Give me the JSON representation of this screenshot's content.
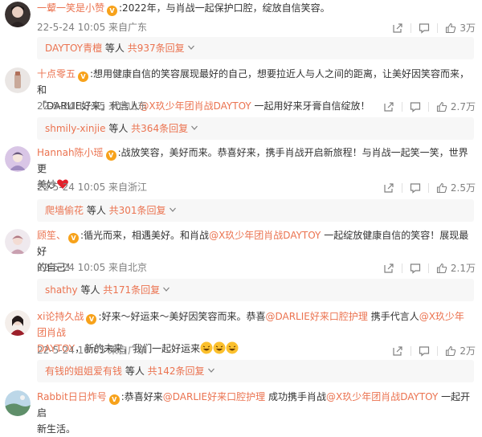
{
  "comments": [
    {
      "username": "一颦一笑是小赞",
      "text_parts": [
        ":2022年，与肖战一起保护口腔，绽放自信笑容。"
      ],
      "meta": "22-5-24 10:05 来自广东",
      "likes": "3万",
      "reply": {
        "user": "DAYTOY青檀",
        "mid": " 等人 ",
        "more": "共937条回复"
      }
    },
    {
      "username": "十点零五",
      "text_parts": [
        ":想用健康自信的笑容展现最好的自己，想要拉近人与人之间的距离，让美好因笑容而来，和",
        "「DARLIE好来」代言人",
        "@X玖少年团肖战DAYTOY",
        " 一起用好来牙膏自信绽放！"
      ],
      "meta": "22-5-24 10:05 来自山东",
      "likes": "2.7万",
      "reply": {
        "user": "shmily-xinjie",
        "mid": " 等人 ",
        "more": "共364条回复"
      }
    },
    {
      "username": "Hannah陈小瑶",
      "text_parts": [
        ":战放笑容，美好而来。恭喜好来，携手肖战开启新旅程！与肖战一起笑一笑，世界更",
        "美妙"
      ],
      "meta": "22-5-24 10:05 来自浙江",
      "likes": "2.5万",
      "reply": {
        "user": "爬墙偷花",
        "mid": " 等人 ",
        "more": "共301条回复"
      }
    },
    {
      "username": "顾笙、",
      "text_parts": [
        ":循光而来，相遇美好。和肖战",
        "@X玖少年团肖战DAYTOY",
        " 一起绽放健康自信的笑容！展现最好",
        "的自己！"
      ],
      "meta": "22-5-24 10:05 来自北京",
      "likes": "2.1万",
      "reply": {
        "user": "shathy",
        "mid": " 等人 ",
        "more": "共171条回复"
      }
    },
    {
      "username": "xi论持久战",
      "text_parts": [
        ":好来～好运来～美好因笑容而来。恭喜",
        "@DARLIE好来口腔护理",
        " 携手代言人",
        "@X玖少年团肖战",
        "DAYTOY",
        "，新的未来，我们一起好运来"
      ],
      "meta": "22-5-24 10:05 来自广东",
      "likes": "2万",
      "reply": {
        "user": "有钱的姐姐爱有钱",
        "mid": " 等人 ",
        "more": "共142条回复"
      }
    },
    {
      "username": "Rabbit日日炸号",
      "text_parts": [
        ":恭喜好来",
        "@DARLIE好来口腔护理",
        " 成功携手肖战",
        "@X玖少年团肖战DAYTOY",
        " 一起开启",
        "新生活。"
      ]
    }
  ],
  "icons": {
    "share": "share-icon",
    "comment": "comment-icon",
    "like": "like-icon",
    "badge": "vip-badge-icon"
  },
  "colors": {
    "accent": "#eb7350",
    "meta": "#808080",
    "replybg": "#f7f7f7"
  }
}
